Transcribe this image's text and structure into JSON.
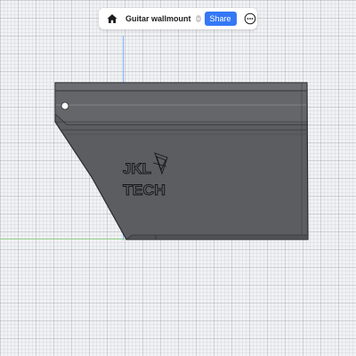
{
  "toolbar": {
    "home_icon": "home-icon",
    "title": "Guitar wallmount",
    "title_menu_icon": "chevron-down-icon",
    "share_label": "Share",
    "more_icon": "more-icon",
    "accent_color": "#3478f6"
  },
  "model": {
    "logo_text": [
      "JKL",
      "TECH"
    ],
    "body_color": "#5c5d61",
    "edge_color": "#2a2b2e"
  }
}
